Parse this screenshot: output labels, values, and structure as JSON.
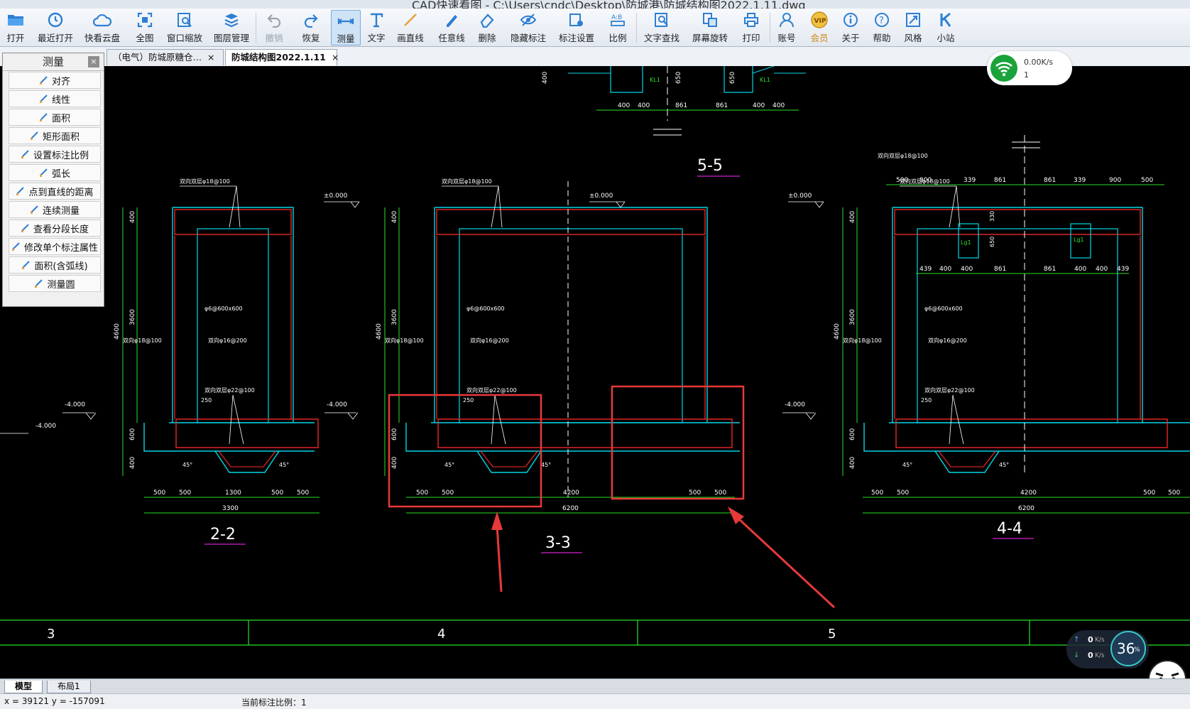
{
  "window": {
    "title": "CAD快速看图 - C:\\Users\\cndc\\Desktop\\防城港\\防城结构图2022.1.11.dwg"
  },
  "toolbar": {
    "items": [
      {
        "label": "打开",
        "icon": "folder-open-icon"
      },
      {
        "label": "最近打开",
        "icon": "clock-icon"
      },
      {
        "label": "快看云盘",
        "icon": "cloud-icon"
      },
      {
        "label": "全图",
        "icon": "fit-all-icon"
      },
      {
        "label": "窗口缩放",
        "icon": "window-zoom-icon"
      },
      {
        "label": "图层管理",
        "icon": "layers-icon"
      },
      {
        "label": "撤销",
        "icon": "undo-icon"
      },
      {
        "label": "恢复",
        "icon": "redo-icon"
      },
      {
        "label": "测量",
        "icon": "measure-icon"
      },
      {
        "label": "文字",
        "icon": "text-icon"
      },
      {
        "label": "画直线",
        "icon": "line-icon"
      },
      {
        "label": "任意线",
        "icon": "freehand-icon"
      },
      {
        "label": "删除",
        "icon": "eraser-icon"
      },
      {
        "label": "隐藏标注",
        "icon": "eye-hide-icon"
      },
      {
        "label": "标注设置",
        "icon": "annotation-settings-icon"
      },
      {
        "label": "比例",
        "icon": "scale-icon"
      },
      {
        "label": "文字查找",
        "icon": "text-search-icon"
      },
      {
        "label": "屏幕旋转",
        "icon": "rotate-screen-icon"
      },
      {
        "label": "打印",
        "icon": "printer-icon"
      },
      {
        "label": "账号",
        "icon": "user-icon"
      },
      {
        "label": "会员",
        "icon": "vip-icon"
      },
      {
        "label": "关于",
        "icon": "info-icon"
      },
      {
        "label": "帮助",
        "icon": "help-icon"
      },
      {
        "label": "风格",
        "icon": "style-icon"
      },
      {
        "label": "小站",
        "icon": "k-site-icon"
      }
    ]
  },
  "tabs": [
    {
      "label": "（电气）防城原糖仓…",
      "close": "×"
    },
    {
      "label": "防城结构图2022.1.11",
      "close": "×"
    }
  ],
  "measure_panel": {
    "title": "测量",
    "close": "×",
    "items": [
      "对齐",
      "线性",
      "面积",
      "矩形面积",
      "设置标注比例",
      "弧长",
      "点到直线的距离",
      "连续测量",
      "查看分段长度",
      "修改单个标注属性",
      "面积(含弧线)",
      "测量圆"
    ]
  },
  "drawing": {
    "section_labels": [
      "5-5",
      "2-2",
      "3-3",
      "4-4"
    ],
    "grid_labels": [
      "3",
      "4",
      "5"
    ],
    "elevations": [
      "±0.000",
      "-4.000"
    ],
    "rebar_notes": [
      "双向双层φ18@100",
      "φ6@600x600",
      "双向φ18@100",
      "双向φ16@200",
      "双向双层φ22@100"
    ],
    "beam_labels": [
      "KL1",
      "Lg1"
    ],
    "dim_2_2": [
      "500",
      "500",
      "1300",
      "500",
      "500",
      "3300"
    ],
    "dim_3_3": [
      "500",
      "500",
      "4200",
      "500",
      "500",
      "6200"
    ],
    "dim_4_4": [
      "500",
      "500",
      "4200",
      "500",
      "500",
      "6200"
    ],
    "dim_vertical": [
      "4600",
      "3600",
      "400",
      "600",
      "400",
      "250"
    ],
    "dim_5_5": [
      "400",
      "400",
      "861",
      "861",
      "400",
      "400",
      "650",
      "650",
      "400"
    ],
    "dim_4_4_top": [
      "500",
      "900",
      "339",
      "861",
      "861",
      "339",
      "900",
      "500",
      "439",
      "400",
      "400",
      "861",
      "861",
      "400",
      "400",
      "439",
      "330",
      "650"
    ],
    "angles": [
      "45°",
      "45°"
    ]
  },
  "network": {
    "speed": "0.00K/s",
    "count": "1"
  },
  "speed_widget": {
    "up": "0",
    "down": "0",
    "unit": "K/s",
    "percent": "36",
    "percent_sign": "%"
  },
  "bottom_tabs": [
    "模型",
    "布局1"
  ],
  "status": {
    "coords": "x = 39121  y = -157091",
    "scale": "当前标注比例：1"
  },
  "colors": {
    "wall_cyan": "#00d6e6",
    "rebar_red": "#ff2a2a",
    "dim_green": "#28e028",
    "highlight_red": "#e8393a",
    "white": "#ffffff",
    "magenta": "#d020d0"
  }
}
